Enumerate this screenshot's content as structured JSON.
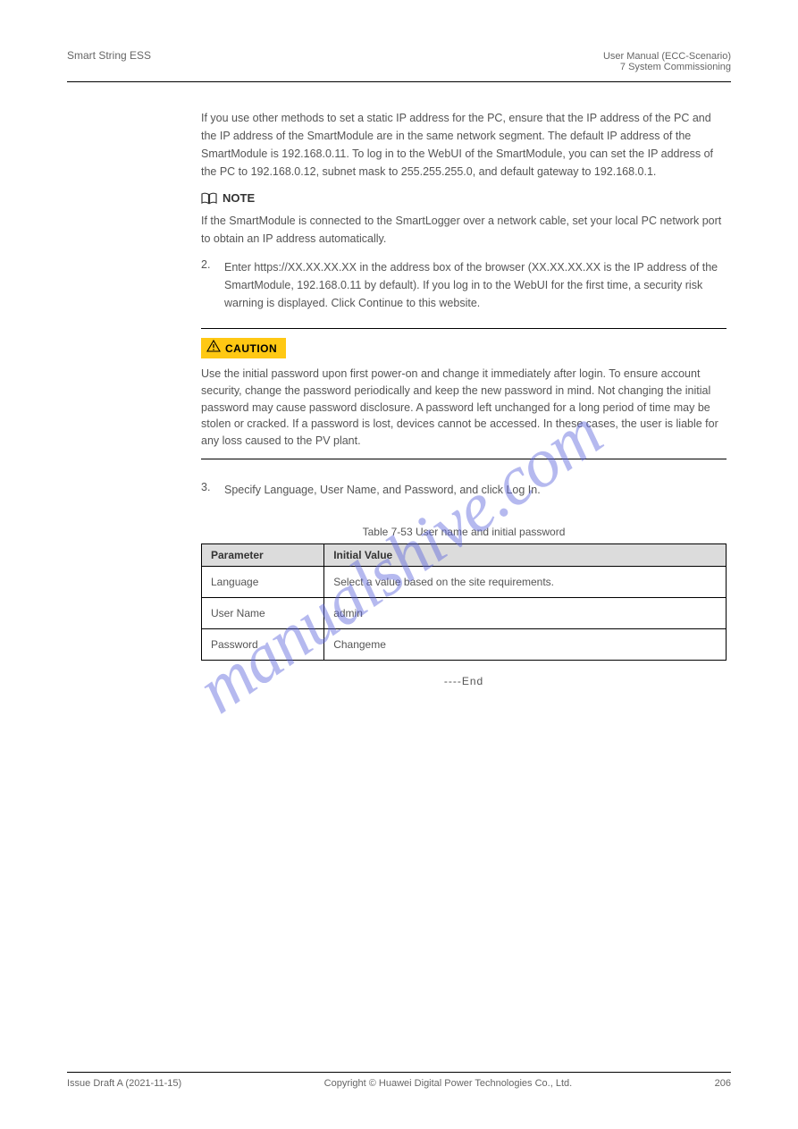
{
  "header": {
    "left": "Smart String ESS",
    "right_title": "User Manual (ECC-Scenario)",
    "right_sub": "7 System Commissioning"
  },
  "intro_para": "If you use other methods to set a static IP address for the PC, ensure that the IP address of the PC and the IP address of the SmartModule are in the same network segment. The default IP address of the SmartModule is 192.168.0.11. To log in to the WebUI of the SmartModule, you can set the IP address of the PC to 192.168.0.12, subnet mask to 255.255.255.0, and default gateway to 192.168.0.1.",
  "note_text": "If the SmartModule is connected to the SmartLogger over a network cable, set your local PC network port to obtain an IP address automatically.",
  "step2": "Enter https://XX.XX.XX.XX in the address box of the browser (XX.XX.XX.XX is the IP address of the SmartModule, 192.168.0.11 by default). If you log in to the WebUI for the first time, a security risk warning is displayed. Click Continue to this website.",
  "callout_text": "Use the initial password upon first power-on and change it immediately after login. To ensure account security, change the password periodically and keep the new password in mind. Not changing the initial password may cause password disclosure. A password left unchanged for a long period of time may be stolen or cracked. If a password is lost, devices cannot be accessed. In these cases, the user is liable for any loss caused to the PV plant.",
  "step3": "Specify Language, User Name, and Password, and click Log In.",
  "table": {
    "caption": "Table 7-53 User name and initial password",
    "headers": [
      "Parameter",
      "Initial Value"
    ],
    "rows": [
      {
        "c1": "Language",
        "c2": "Select a value based on the site requirements."
      },
      {
        "c1": "User Name",
        "c2": "admin"
      },
      {
        "c1": "Password",
        "c2": "Changeme"
      }
    ]
  },
  "end": "----End",
  "footer": {
    "left": "Issue Draft A (2021-11-15)",
    "center": "Copyright © Huawei Digital Power Technologies Co., Ltd.",
    "right": "206"
  },
  "watermark": "manualshive.com"
}
